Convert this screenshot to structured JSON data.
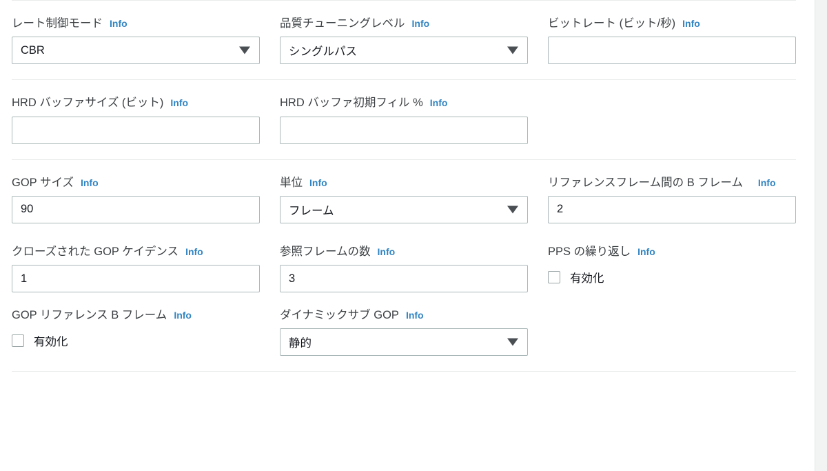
{
  "form": {
    "groups": [
      {
        "id": "rate-control",
        "fields": [
          {
            "name": "rate-control-mode",
            "label": "レート制御モード",
            "info": "Info",
            "control": "select",
            "value": "CBR"
          },
          {
            "name": "quality-tuning-level",
            "label": "品質チューニングレベル",
            "info": "Info",
            "control": "select",
            "value": "シングルパス"
          },
          {
            "name": "bitrate",
            "label": "ビットレート (ビット/秒)",
            "info": "Info",
            "control": "input",
            "value": "",
            "placeholder": ""
          }
        ]
      },
      {
        "id": "hrd-buffer",
        "fields": [
          {
            "name": "hrd-buffer-size",
            "label": "HRD バッファサイズ (ビット)",
            "info": "Info",
            "control": "input",
            "value": "",
            "placeholder": ""
          },
          {
            "name": "hrd-buffer-initial-fill",
            "label": "HRD バッファ初期フィル %",
            "info": "Info",
            "control": "input",
            "value": "",
            "placeholder": ""
          }
        ]
      },
      {
        "id": "gop-settings",
        "fields": [
          {
            "name": "gop-size",
            "label": "GOP サイズ",
            "info": "Info",
            "control": "input",
            "value": "90",
            "placeholder": ""
          },
          {
            "name": "gop-size-units",
            "label": "単位",
            "info": "Info",
            "control": "select",
            "value": "フレーム"
          },
          {
            "name": "b-frames-between-reference-frames",
            "label": "リファレンスフレーム間の B フレーム",
            "info": "Info",
            "control": "input",
            "value": "2",
            "placeholder": "",
            "wrap": true
          },
          {
            "name": "closed-gop-cadence",
            "label": "クローズされた GOP ケイデンス",
            "info": "Info",
            "control": "input",
            "value": "1",
            "placeholder": ""
          },
          {
            "name": "number-of-reference-frames",
            "label": "参照フレームの数",
            "info": "Info",
            "control": "input",
            "value": "3",
            "placeholder": ""
          },
          {
            "name": "pps-repetition",
            "label": "PPS の繰り返し",
            "info": "Info",
            "control": "checkbox",
            "checkbox_label": "有効化",
            "checked": false
          },
          {
            "name": "gop-reference-b-frame",
            "label": "GOP リファレンス B フレーム",
            "info": "Info",
            "control": "checkbox",
            "checkbox_label": "有効化",
            "checked": false
          },
          {
            "name": "dynamic-sub-gop",
            "label": "ダイナミックサブ GOP",
            "info": "Info",
            "control": "select",
            "value": "静的"
          }
        ]
      }
    ]
  },
  "colors": {
    "info_link": "#3184c2",
    "label_text": "#3d4144",
    "input_border": "#aab7b8",
    "divider": "#e9ebeb",
    "value_text": "#16191f",
    "gutter": "#f2f3f3"
  }
}
